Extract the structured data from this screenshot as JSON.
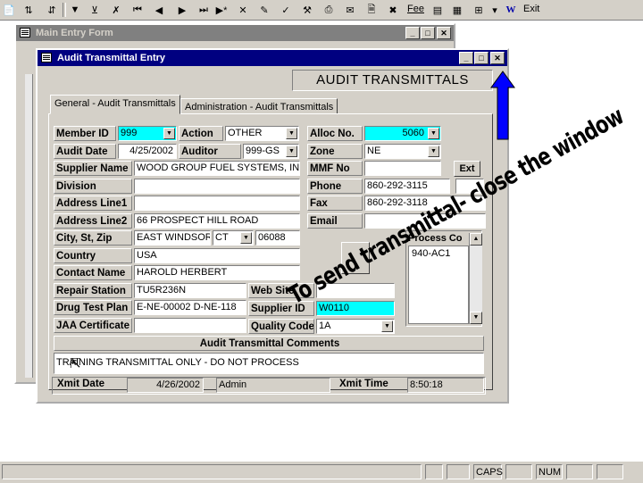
{
  "toolbar": {
    "font_button": "Fee",
    "exit_label": "Exit"
  },
  "main_window": {
    "title": "Main Entry Form"
  },
  "audit_window": {
    "title": "Audit Transmittal Entry",
    "header_label": "AUDIT TRANSMITTALS",
    "tabs": [
      {
        "label": "General - Audit Transmittals"
      },
      {
        "label": "Administration - Audit Transmittals"
      }
    ],
    "fields": {
      "member_id": {
        "label": "Member ID",
        "value": "999"
      },
      "action": {
        "label": "Action",
        "value": "OTHER"
      },
      "alloc_no": {
        "label": "Alloc No.",
        "value": "5060"
      },
      "audit_date": {
        "label": "Audit Date",
        "value": "4/25/2002"
      },
      "auditor": {
        "label": "Auditor",
        "value": "999-GS"
      },
      "zone": {
        "label": "Zone",
        "value": "NE"
      },
      "supplier_name": {
        "label": "Supplier Name",
        "value": "WOOD GROUP FUEL SYSTEMS, IN"
      },
      "mmf_no": {
        "label": "MMF No",
        "value": ""
      },
      "ext_button": "Ext",
      "division": {
        "label": "Division",
        "value": ""
      },
      "phone": {
        "label": "Phone",
        "value": "860-292-3115"
      },
      "address1": {
        "label": "Address Line1",
        "value": ""
      },
      "fax": {
        "label": "Fax",
        "value": "860-292-3118"
      },
      "address2": {
        "label": "Address Line2",
        "value": "66 PROSPECT HILL ROAD"
      },
      "email": {
        "label": "Email",
        "value": ""
      },
      "city_st_zip": {
        "label": "City, St, Zip",
        "city": "EAST WINDSOR",
        "state": "CT",
        "zip": "06088"
      },
      "country": {
        "label": "Country",
        "value": "USA"
      },
      "contact_name": {
        "label": "Contact Name",
        "value": "HAROLD HERBERT"
      },
      "repair_station": {
        "label": "Repair Station",
        "value": "TU5R236N"
      },
      "web_site": {
        "label": "Web Site",
        "value": ""
      },
      "drug_test_plan": {
        "label": "Drug Test Plan",
        "value": "E-NE-00002 D-NE-118"
      },
      "supplier_id": {
        "label": "Supplier ID",
        "value": "W0110"
      },
      "jaa_certificate": {
        "label": "JAA Certificate",
        "value": ""
      },
      "quality_code": {
        "label": "Quality Code",
        "value": "1A"
      },
      "process_codes": {
        "label": "Process Co",
        "items": [
          "940-AC1"
        ]
      },
      "comments_label": "Audit Transmittal Comments",
      "comments_value": "TRAINING TRANSMITTAL ONLY - DO NOT PROCESS",
      "xmit_date": {
        "label": "Xmit Date",
        "value": "4/26/2002"
      },
      "xmit_user": "Admin",
      "xmit_time": {
        "label": "Xmit Time",
        "value": "8:50:18"
      }
    }
  },
  "annotation": "To send transmittal- close the window",
  "statusbar": {
    "caps": "CAPS",
    "num": "NUM"
  },
  "colors": {
    "title_active": "#000080",
    "highlight_field": "#00ffff",
    "arrow": "#0000ff"
  }
}
